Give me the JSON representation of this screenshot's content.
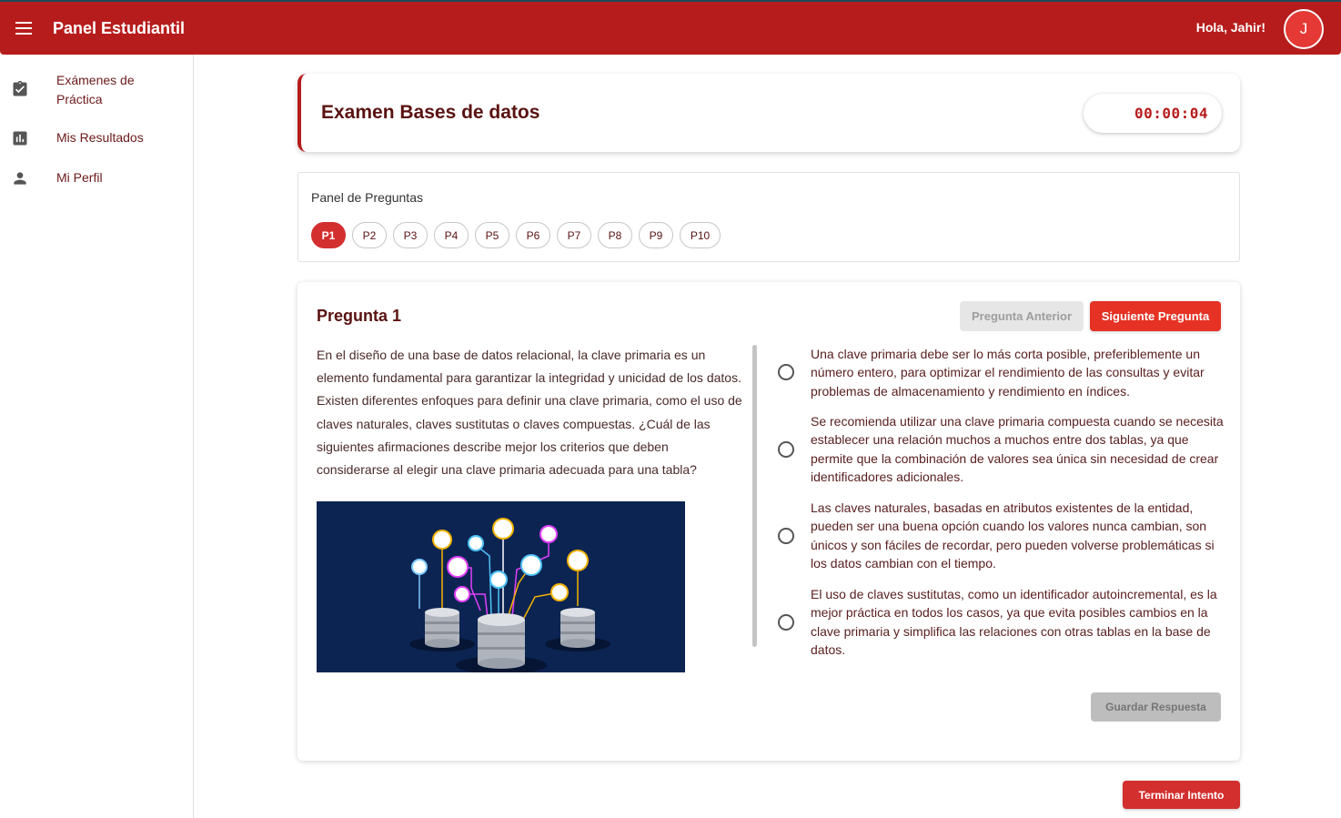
{
  "app": {
    "title": "Panel Estudiantil",
    "greeting": "Hola, Jahir!",
    "avatar_initial": "J",
    "menu_icon": "menu-icon"
  },
  "colors": {
    "primary": "#b71c1c",
    "accent": "#e53224",
    "timer_text": "#b71c1c",
    "disabled_bg": "#e6e6e6"
  },
  "sidebar": {
    "items": [
      {
        "label": "Exámenes de Práctica",
        "icon": "assignment-check-icon"
      },
      {
        "label": "Mis Resultados",
        "icon": "bar-chart-icon"
      },
      {
        "label": "Mi Perfil",
        "icon": "person-icon"
      }
    ]
  },
  "exam": {
    "title": "Examen Bases de datos",
    "timer": "00:00:04"
  },
  "question_panel": {
    "title": "Panel de Preguntas",
    "active": "P1",
    "chips": [
      "P1",
      "P2",
      "P3",
      "P4",
      "P5",
      "P6",
      "P7",
      "P8",
      "P9",
      "P10"
    ]
  },
  "question": {
    "title": "Pregunta 1",
    "prev_label": "Pregunta Anterior",
    "next_label": "Siguiente Pregunta",
    "text": "En el diseño de una base de datos relacional, la clave primaria es un elemento fundamental para garantizar la integridad y unicidad de los datos. Existen diferentes enfoques para definir una clave primaria, como el uso de claves naturales, claves sustitutas o claves compuestas. ¿Cuál de las siguientes afirmaciones describe mejor los criterios que deben considerarse al elegir una clave primaria adecuada para una tabla?",
    "image": "database-network-illustration",
    "options": [
      "Una clave primaria debe ser lo más corta posible, preferiblemente un número entero, para optimizar el rendimiento de las consultas y evitar problemas de almacenamiento y rendimiento en índices.",
      "Se recomienda utilizar una clave primaria compuesta cuando se necesita establecer una relación muchos a muchos entre dos tablas, ya que permite que la combinación de valores sea única sin necesidad de crear identificadores adicionales.",
      "Las claves naturales, basadas en atributos existentes de la entidad, pueden ser una buena opción cuando los valores nunca cambian, son únicos y son fáciles de recordar, pero pueden volverse problemáticas si los datos cambian con el tiempo.",
      "El uso de claves sustitutas, como un identificador autoincremental, es la mejor práctica en todos los casos, ya que evita posibles cambios en la clave primaria y simplifica las relaciones con otras tablas en la base de datos."
    ],
    "save_label": "Guardar Respuesta"
  },
  "footer": {
    "end_label": "Terminar Intento"
  }
}
